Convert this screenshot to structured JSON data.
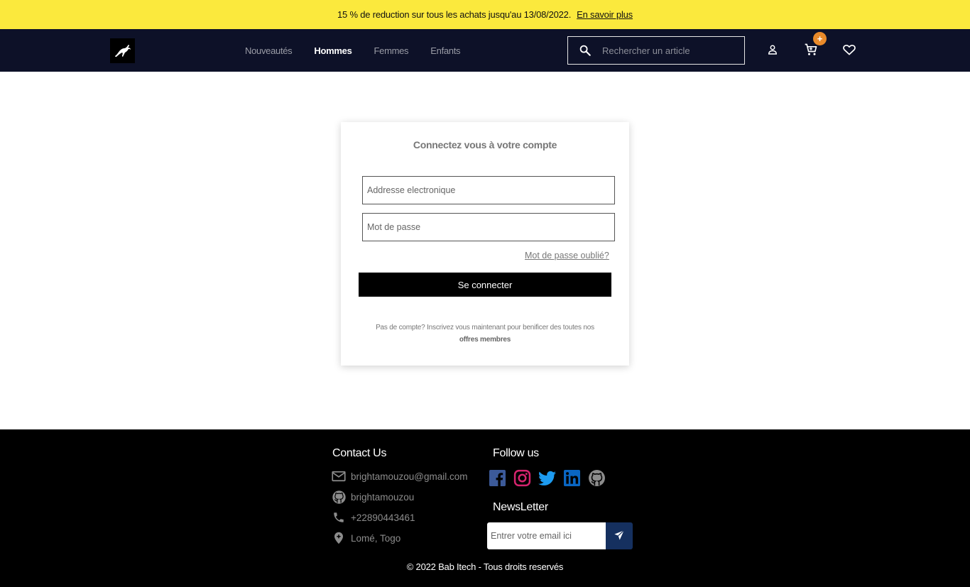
{
  "promo": {
    "text": "15 % de reduction sur tous les achats jusqu'au 13/08/2022.",
    "link": "En savoir plus"
  },
  "nav": {
    "logo_icon": "puma-logo",
    "menu": [
      "Nouveautés",
      "Hommes",
      "Femmes",
      "Enfants"
    ],
    "active_menu": "Hommes",
    "search_placeholder": "Rechercher un article",
    "cart_badge": "+",
    "icons": [
      "search-icon",
      "user-icon",
      "cart-icon",
      "heart-icon"
    ]
  },
  "login": {
    "title": "Connectez vous à votre compte",
    "email_placeholder": "Addresse electronique",
    "password_placeholder": "Mot de passe",
    "forgot": "Mot de passe oublié?",
    "submit": "Se connecter",
    "signup_text": "Pas de compte? Inscrivez vous maintenant pour benificer des toutes nos",
    "signup_link": "offres membres"
  },
  "footer": {
    "contact_heading": "Contact Us",
    "contacts": [
      {
        "icon": "mail-icon",
        "text": "brightamouzou@gmail.com"
      },
      {
        "icon": "github-icon",
        "text": "brightamouzou"
      },
      {
        "icon": "phone-icon",
        "text": "+22890443461"
      },
      {
        "icon": "location-icon",
        "text": "Lomé, Togo"
      }
    ],
    "follow_heading": "Follow us",
    "socials": [
      "facebook-icon",
      "instagram-icon",
      "twitter-icon",
      "linkedin-icon",
      "github-icon"
    ],
    "newsletter_heading": "NewsLetter",
    "newsletter_placeholder": "Entrer votre email ici",
    "copyright": "© 2022 Bab Itech - Tous droits reservés"
  },
  "colors": {
    "promo_bg": "#fbe93d",
    "nav_bg": "#0d1128",
    "badge": "#e98a2a",
    "newsletter_button": "#15305f",
    "footer_bg": "#000000"
  }
}
